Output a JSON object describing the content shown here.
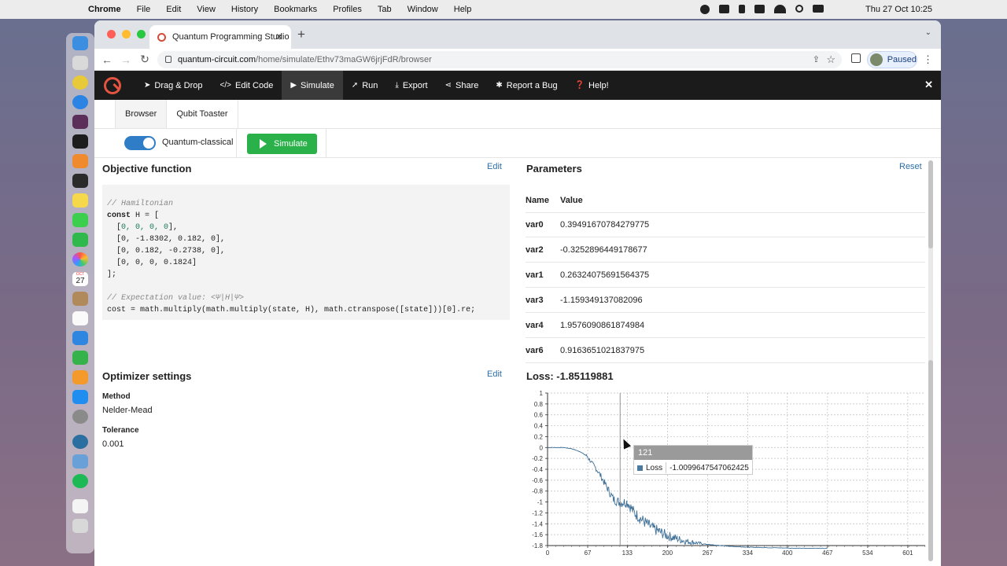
{
  "menubar": {
    "app": "Chrome",
    "items": [
      "File",
      "Edit",
      "View",
      "History",
      "Bookmarks",
      "Profiles",
      "Tab",
      "Window",
      "Help"
    ],
    "clock": "Thu 27 Oct  10:25"
  },
  "dock": {
    "calendar_month": "OCT",
    "calendar_day": "27"
  },
  "browser": {
    "tab_title": "Quantum Programming Studio",
    "url_host": "quantum-circuit.com",
    "url_path": "/home/simulate/Ethv73maGW6jrjFdR/browser",
    "profile_label": "Paused"
  },
  "toolbar": {
    "items": [
      {
        "label": "Drag & Drop",
        "icon": "pointer-icon"
      },
      {
        "label": "Edit Code",
        "icon": "code-icon"
      },
      {
        "label": "Simulate",
        "icon": "play-icon"
      },
      {
        "label": "Run",
        "icon": "rocket-icon"
      },
      {
        "label": "Export",
        "icon": "download-icon"
      },
      {
        "label": "Share",
        "icon": "share-icon"
      },
      {
        "label": "Report a Bug",
        "icon": "bug-icon"
      },
      {
        "label": "Help!",
        "icon": "question-icon"
      }
    ],
    "active": "Simulate"
  },
  "subtabs": [
    "Browser",
    "Qubit Toaster"
  ],
  "controls": {
    "toggle_label": "Quantum-classical",
    "toggle_on": true,
    "simulate_button": "Simulate"
  },
  "objective": {
    "title": "Objective function",
    "edit_label": "Edit",
    "code": {
      "comment1": "// Hamiltonian",
      "l1_kw": "const",
      "l1_rest": " H = [",
      "row1_pre": "  [",
      "row1_nums": "0, 0, 0, 0",
      "row1_post": "],",
      "row2": "  [0, -1.8302, 0.182, 0],",
      "row3": "  [0, 0.182, -0.2738, 0],",
      "row4": "  [0, 0, 0, 0.1824]",
      "close": "];",
      "comment2": "// Expectation value: <Ψ|H|Ψ>",
      "cost": "cost = math.multiply(math.multiply(state, H), math.ctranspose([state]))[0].re;"
    }
  },
  "optimizer": {
    "title": "Optimizer settings",
    "edit_label": "Edit",
    "method_label": "Method",
    "method_value": "Nelder-Mead",
    "tolerance_label": "Tolerance",
    "tolerance_value": "0.001"
  },
  "parameters": {
    "title": "Parameters",
    "reset_label": "Reset",
    "col_name": "Name",
    "col_value": "Value",
    "rows": [
      {
        "name": "var0",
        "value": "0.39491670784279775"
      },
      {
        "name": "var2",
        "value": "-0.3252896449178677"
      },
      {
        "name": "var1",
        "value": "0.26324075691564375"
      },
      {
        "name": "var3",
        "value": "-1.159349137082096"
      },
      {
        "name": "var4",
        "value": "1.9576090861874984"
      },
      {
        "name": "var6",
        "value": "0.9163651021837975"
      }
    ]
  },
  "loss": {
    "title": "Loss: -1.85119881",
    "tooltip_iter": "121",
    "tooltip_series": "Loss",
    "tooltip_value": "-1.0099647547062425"
  },
  "chart_data": {
    "type": "line",
    "title": "",
    "xlabel": "",
    "ylabel": "",
    "xlim": [
      0,
      630
    ],
    "ylim": [
      -1.8,
      1
    ],
    "x_ticks": [
      "0",
      "67",
      "133",
      "200",
      "267",
      "334",
      "400",
      "467",
      "534",
      "601"
    ],
    "y_ticks": [
      "1",
      "0.8",
      "0.6",
      "0.4",
      "0.2",
      "0",
      "-0.2",
      "-0.4",
      "-0.6",
      "-0.8",
      "-1",
      "-1.2",
      "-1.4",
      "-1.6",
      "-1.8"
    ],
    "grid": true,
    "series": [
      {
        "name": "Loss",
        "x": [
          0,
          25,
          40,
          55,
          65,
          75,
          85,
          95,
          105,
          110,
          121,
          133,
          145,
          160,
          175,
          200,
          230,
          267,
          300,
          334,
          380,
          420,
          467
        ],
        "y": [
          0,
          0,
          -0.02,
          -0.08,
          -0.15,
          -0.3,
          -0.45,
          -0.65,
          -0.85,
          -0.95,
          -1.01,
          -1.0,
          -1.2,
          -1.35,
          -1.48,
          -1.62,
          -1.72,
          -1.78,
          -1.81,
          -1.83,
          -1.84,
          -1.85,
          -1.85
        ]
      }
    ],
    "hover_x": 121,
    "colors": {
      "line": "#3d6f97",
      "grid": "#bdbdbd"
    }
  }
}
